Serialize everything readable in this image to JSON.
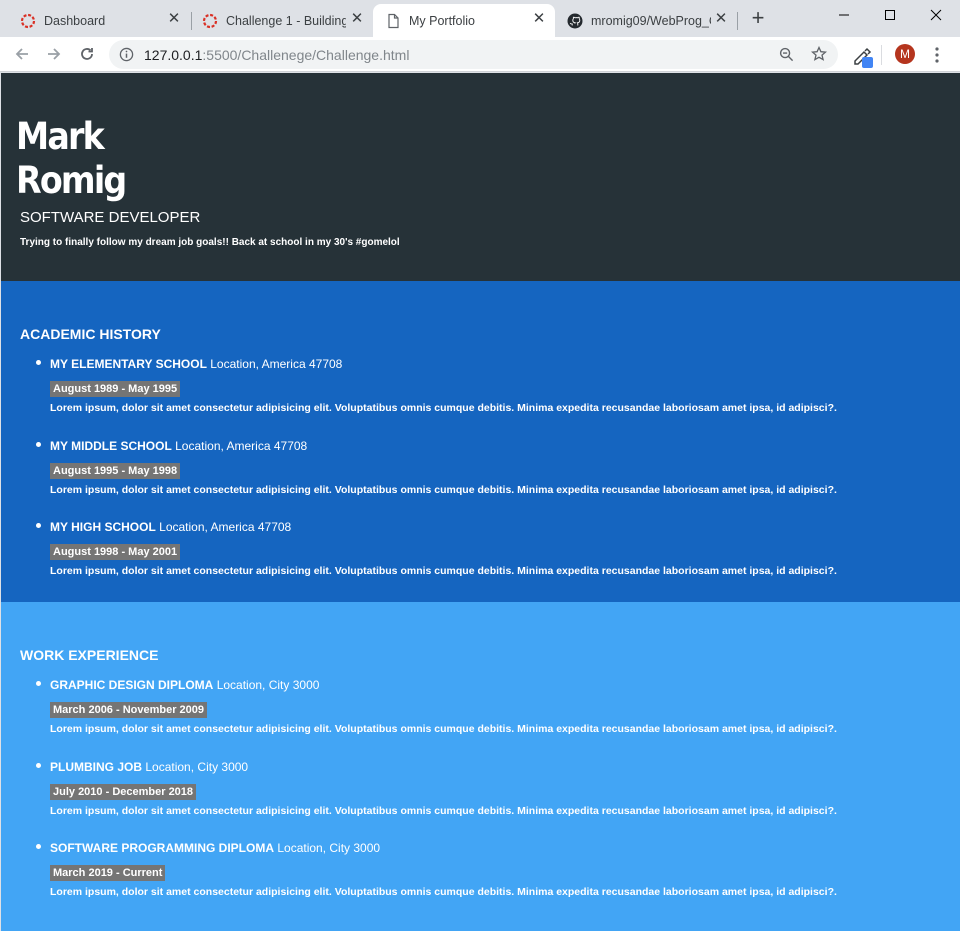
{
  "browser": {
    "tabs": [
      {
        "title": "Dashboard",
        "icon": "spinner-icon"
      },
      {
        "title": "Challenge 1 - Building",
        "icon": "spinner-icon"
      },
      {
        "title": "My Portfolio",
        "icon": "page-icon"
      },
      {
        "title": "mromig09/WebProg_C",
        "icon": "github-icon"
      }
    ],
    "url_host": "127.0.0.1",
    "url_rest": ":5500/Challenege/Challenge.html",
    "profile_initial": "M",
    "accent": "#d93025"
  },
  "hero": {
    "first_name": "Mark",
    "last_name": "Romig",
    "role": "SOFTWARE DEVELOPER",
    "tagline": "Trying to finally follow my dream job goals!! Back at school in my 30's #gomelol",
    "bg": "#263238"
  },
  "academic": {
    "heading": "ACADEMIC HISTORY",
    "bg": "#1565c0",
    "items": [
      {
        "title": "MY ELEMENTARY SCHOOL",
        "location": "Location, America 47708",
        "dates": "August 1989 - May 1995",
        "desc": "Lorem ipsum, dolor sit amet consectetur adipisicing elit. Voluptatibus omnis cumque debitis. Minima expedita recusandae laboriosam amet ipsa, id adipisci?."
      },
      {
        "title": "MY MIDDLE SCHOOL",
        "location": "Location, America 47708",
        "dates": "August 1995 - May 1998",
        "desc": "Lorem ipsum, dolor sit amet consectetur adipisicing elit. Voluptatibus omnis cumque debitis. Minima expedita recusandae laboriosam amet ipsa, id adipisci?."
      },
      {
        "title": "MY HIGH SCHOOL",
        "location": "Location, America 47708",
        "dates": "August 1998 - May 2001",
        "desc": "Lorem ipsum, dolor sit amet consectetur adipisicing elit. Voluptatibus omnis cumque debitis. Minima expedita recusandae laboriosam amet ipsa, id adipisci?."
      }
    ]
  },
  "work": {
    "heading": "WORK EXPERIENCE",
    "bg": "#42a5f5",
    "items": [
      {
        "title": "GRAPHIC DESIGN DIPLOMA",
        "location": "Location, City 3000",
        "dates": "March 2006 - November 2009",
        "desc": "Lorem ipsum, dolor sit amet consectetur adipisicing elit. Voluptatibus omnis cumque debitis. Minima expedita recusandae laboriosam amet ipsa, id adipisci?."
      },
      {
        "title": "PLUMBING JOB",
        "location": "Location, City 3000",
        "dates": "July 2010 - December 2018",
        "desc": "Lorem ipsum, dolor sit amet consectetur adipisicing elit. Voluptatibus omnis cumque debitis. Minima expedita recusandae laboriosam amet ipsa, id adipisci?."
      },
      {
        "title": "SOFTWARE PROGRAMMING DIPLOMA",
        "location": "Location, City 3000",
        "dates": "March 2019 - Current",
        "desc": "Lorem ipsum, dolor sit amet consectetur adipisicing elit. Voluptatibus omnis cumque debitis. Minima expedita recusandae laboriosam amet ipsa, id adipisci?."
      }
    ]
  }
}
